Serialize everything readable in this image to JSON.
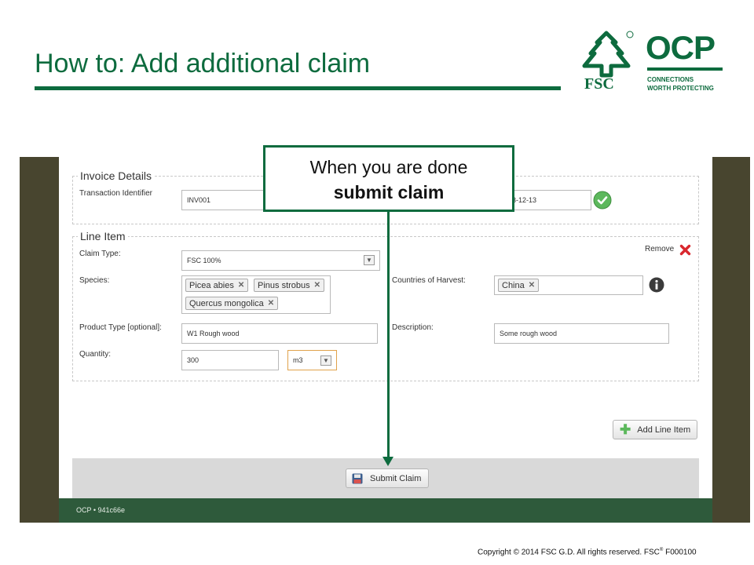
{
  "slide": {
    "title": "How to: Add additional claim",
    "copyright": "Copyright © 2014 FSC G.D. All rights reserved. FSC",
    "copyright_reg": "®",
    "copyright_code": " F000100"
  },
  "logos": {
    "fsc_text": "FSC",
    "ocp_text": "OCP",
    "ocp_tagline_1": "CONNECTIONS",
    "ocp_tagline_2": "WORTH PROTECTING",
    "brand_color": "#0d6b3e"
  },
  "callout": {
    "line1": "When you are done",
    "line2": "submit claim"
  },
  "invoice": {
    "legend": "Invoice Details",
    "transaction_label": "Transaction Identifier",
    "transaction_value": "INV001",
    "date_value": "3-12-13"
  },
  "line_item": {
    "legend": "Line Item",
    "remove_label": "Remove",
    "claim_type_label": "Claim Type:",
    "claim_type_value": "FSC 100%",
    "species_label": "Species:",
    "species": [
      "Picea abies",
      "Pinus strobus",
      "Quercus mongolica"
    ],
    "countries_label": "Countries of Harvest:",
    "countries": [
      "China"
    ],
    "product_type_label": "Product Type [optional]:",
    "product_type_value": "W1 Rough wood",
    "description_label": "Description:",
    "description_value": "Some rough wood",
    "quantity_label": "Quantity:",
    "quantity_value": "300",
    "unit_value": "m3"
  },
  "actions": {
    "add_line_item": "Add Line Item",
    "submit_claim": "Submit Claim"
  },
  "footer": {
    "text": "OCP • 941c66e"
  }
}
